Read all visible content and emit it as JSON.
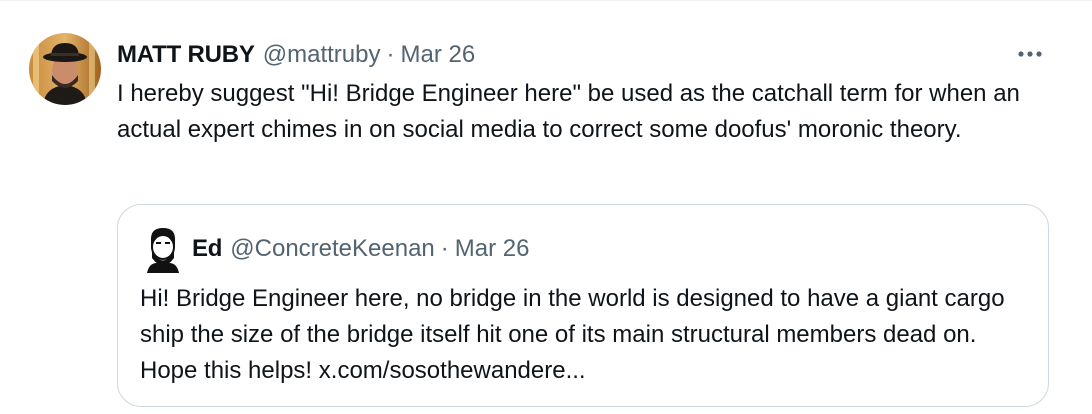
{
  "tweet": {
    "author_name": "MATT RUBY",
    "author_handle": "@mattruby",
    "separator": "·",
    "date": "Mar 26",
    "text": "I hereby suggest \"Hi! Bridge Engineer here\" be used as the catchall term for when an actual expert chimes in on social media to correct some doofus' moronic theory.",
    "more_icon": "more-horizontal-icon"
  },
  "quoted": {
    "author_name": "Ed",
    "author_handle": "@ConcreteKeenan",
    "separator": "·",
    "date": "Mar 26",
    "text": "Hi! Bridge Engineer here, no bridge in the world is designed to have a giant cargo ship the size of the bridge itself hit one of its main structural members dead on. Hope this helps! ",
    "link_text": "x.com/sosothewandere..."
  },
  "colors": {
    "text_primary": "#0f1419",
    "text_secondary": "#536471",
    "border": "#cfd9de"
  }
}
